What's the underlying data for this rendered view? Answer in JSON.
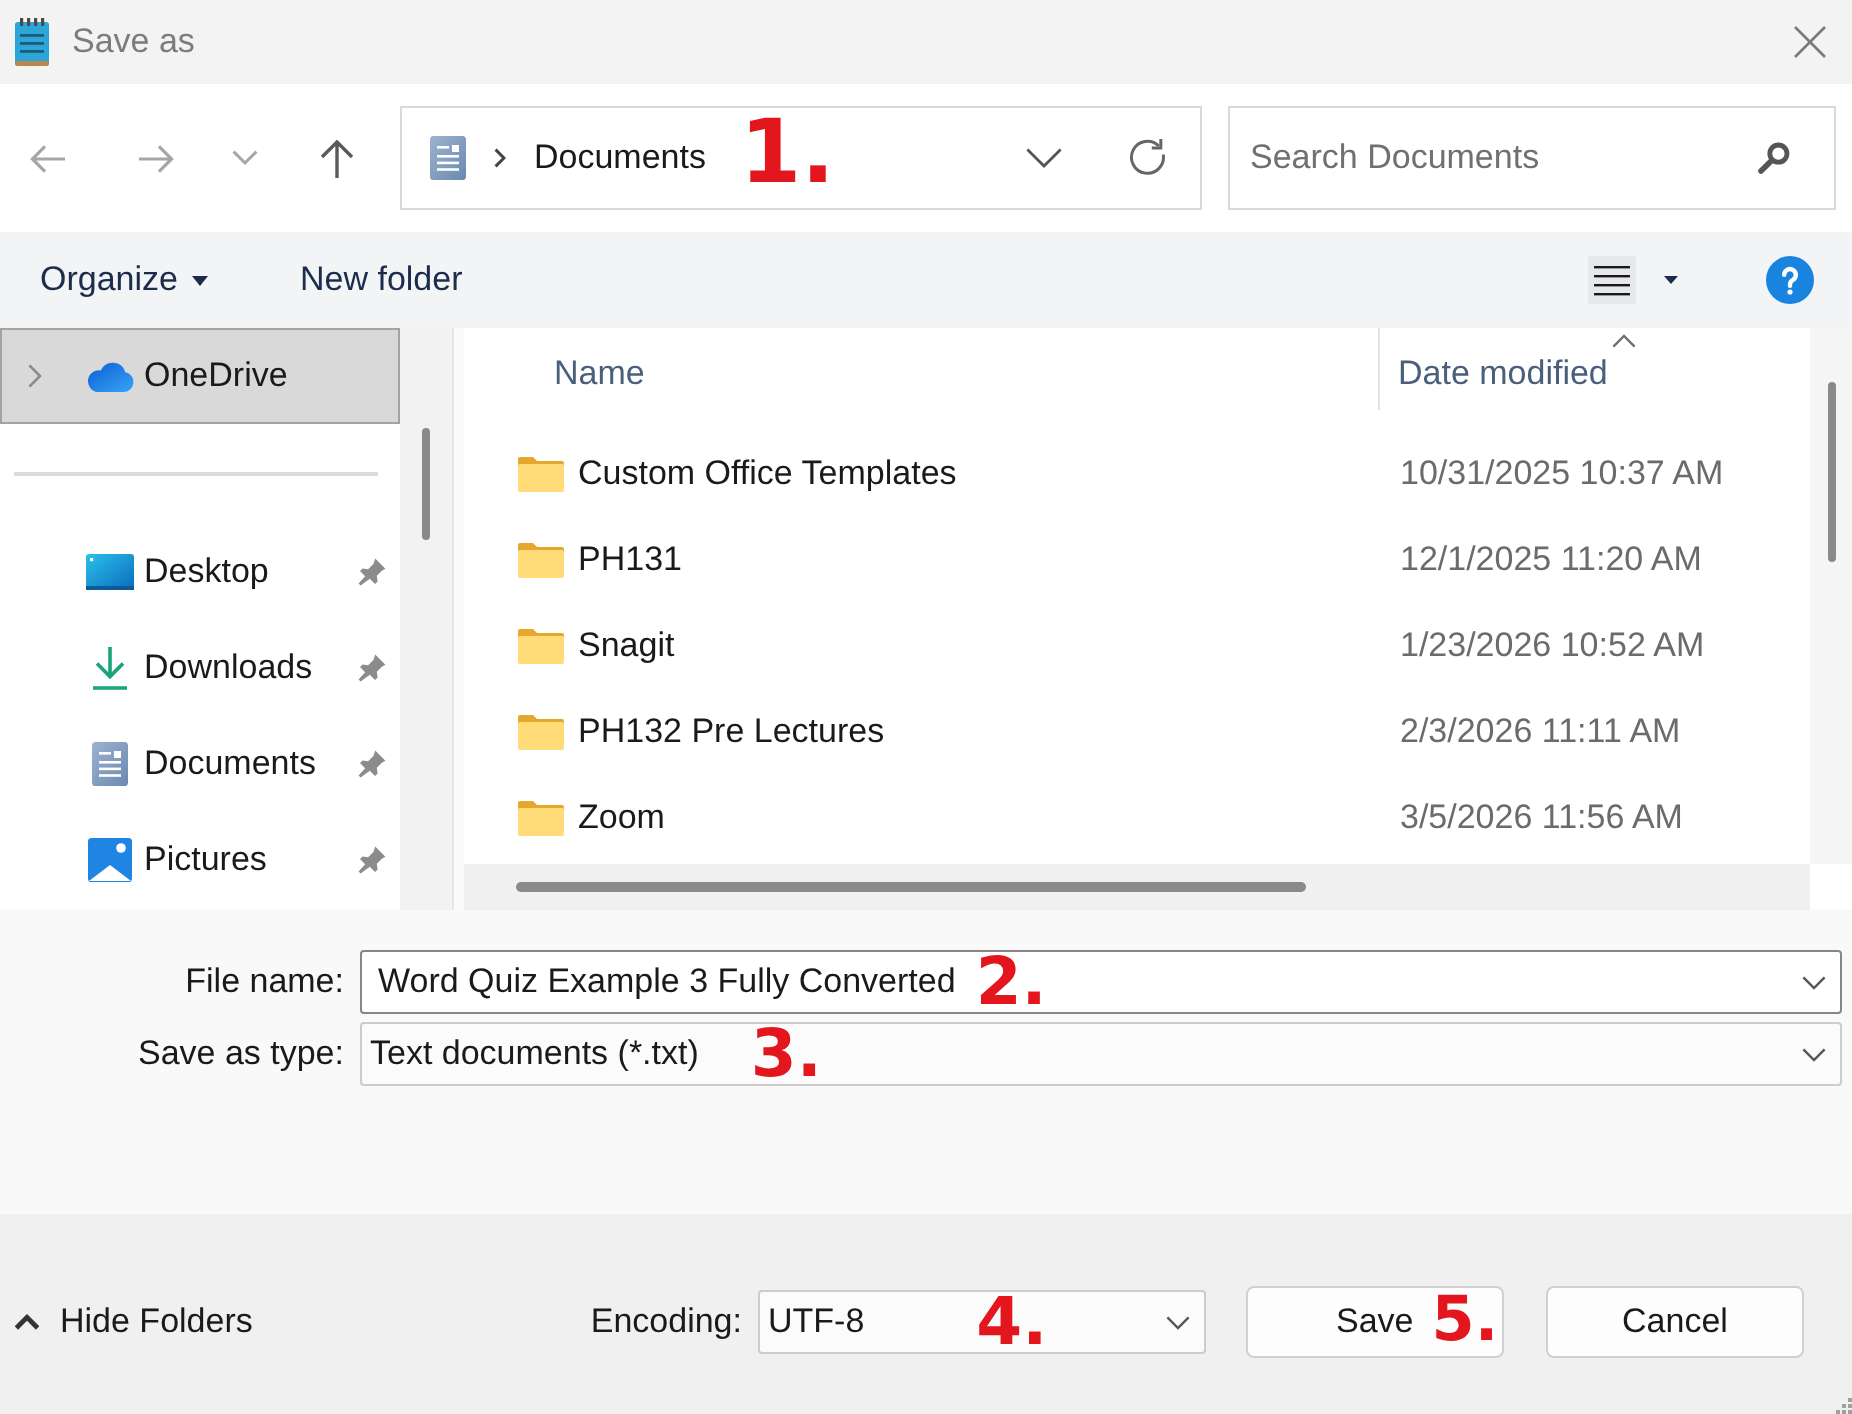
{
  "window": {
    "title": "Save as"
  },
  "nav": [
    {
      "kind": "back",
      "disabled": true
    },
    {
      "kind": "forward",
      "disabled": true
    },
    {
      "kind": "recent",
      "disabled": true
    },
    {
      "kind": "up",
      "disabled": false
    }
  ],
  "address_bar": {
    "breadcrumbs": [
      "Documents"
    ],
    "annotation": "1."
  },
  "search": {
    "placeholder": "Search Documents"
  },
  "toolbar": [
    {
      "kind": "menu",
      "label": "Organize"
    },
    {
      "kind": "button",
      "label": "New folder"
    }
  ],
  "sidebar": {
    "locations": [
      {
        "label": "OneDrive",
        "selected": true,
        "expanded": false
      }
    ],
    "quick_access": [
      {
        "label": "Desktop",
        "selected": false,
        "pinned": true
      },
      {
        "label": "Downloads",
        "selected": false,
        "pinned": true
      },
      {
        "label": "Documents",
        "selected": false,
        "pinned": true
      },
      {
        "label": "Pictures",
        "selected": false,
        "pinned": true
      }
    ]
  },
  "file_list": {
    "columns": [
      {
        "label": "Name",
        "sorted": false
      },
      {
        "label": "Date modified",
        "sorted": true
      }
    ],
    "rows": [
      {
        "name": "Custom Office Templates",
        "date_modified": "10/31/2025 10:37 AM"
      },
      {
        "name": "PH131",
        "date_modified": "12/1/2025 11:20 AM"
      },
      {
        "name": "Snagit",
        "date_modified": "1/23/2026 10:52 AM"
      },
      {
        "name": "PH132 Pre Lectures",
        "date_modified": "2/3/2026 11:11 AM"
      },
      {
        "name": "Zoom",
        "date_modified": "3/5/2026 11:56 AM"
      }
    ]
  },
  "form": {
    "file_name": {
      "label": "File name:",
      "value": "Word Quiz Example 3 Fully Converted",
      "annotation": "2."
    },
    "save_as_type": {
      "label": "Save as type:",
      "value": "Text documents (*.txt)",
      "annotation": "3."
    }
  },
  "footer": {
    "hide_folders": "Hide Folders",
    "encoding": {
      "label": "Encoding:",
      "value": "UTF-8",
      "annotation": "4."
    },
    "buttons": [
      {
        "label": "Save",
        "annotation": "5."
      },
      {
        "label": "Cancel"
      }
    ]
  }
}
